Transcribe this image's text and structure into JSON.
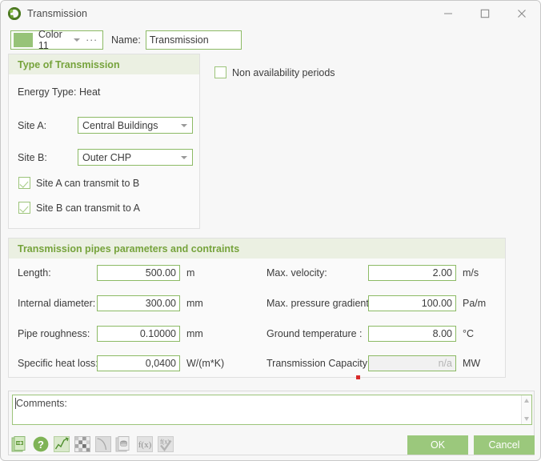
{
  "window": {
    "title": "Transmission",
    "app_icon": "ring-icon",
    "controls": {
      "minimize": "minimize-icon",
      "maximize": "maximize-icon",
      "close": "close-icon"
    }
  },
  "header_row": {
    "color_value": "Color 11",
    "color_swatch_hex": "#97c378",
    "ellipsis": "···",
    "name_label": "Name:",
    "name_value": "Transmission"
  },
  "type_group": {
    "title": "Type of Transmission",
    "energy_type_label": "Energy Type:",
    "energy_type_value": "Heat",
    "site_a_label": "Site A:",
    "site_a_value": "Central Buildings",
    "site_b_label": "Site B:",
    "site_b_value": "Outer CHP",
    "checkbox_a_to_b": "Site A can transmit to B",
    "checkbox_b_to_a": "Site B can transmit to A",
    "checkbox_a_to_b_checked": true,
    "checkbox_b_to_a_checked": true
  },
  "non_availability": {
    "label": "Non availability periods",
    "checked": false
  },
  "pipes_group": {
    "title": "Transmission pipes parameters and contraints",
    "left_fields": [
      {
        "label": "Length:",
        "value": "500.00",
        "unit": "m",
        "disabled": false
      },
      {
        "label": "Internal diameter:",
        "value": "300.00",
        "unit": "mm",
        "disabled": false
      },
      {
        "label": "Pipe roughness:",
        "value": "0.10000",
        "unit": "mm",
        "disabled": false
      },
      {
        "label": "Specific heat loss:",
        "value": "0,0400",
        "unit": "W/(m*K)",
        "disabled": false
      }
    ],
    "right_fields": [
      {
        "label": "Max. velocity:",
        "value": "2.00",
        "unit": "m/s",
        "disabled": false
      },
      {
        "label": "Max. pressure gradient:",
        "value": "100.00",
        "unit": "Pa/m",
        "disabled": false
      },
      {
        "label": "Ground temperature :",
        "value": "8.00",
        "unit": "°C",
        "disabled": false
      },
      {
        "label": "Transmission Capacity:",
        "value": "n/a",
        "unit": "MW",
        "disabled": true
      }
    ]
  },
  "comments": {
    "text": "Comments:"
  },
  "toolbar": {
    "icons": [
      "export-document-icon",
      "help-icon",
      "chart-line-icon",
      "heatmap-icon",
      "curve-icon",
      "database-document-icon",
      "function-icon",
      "function-check-icon"
    ]
  },
  "buttons": {
    "ok": "OK",
    "cancel": "Cancel"
  },
  "colors": {
    "accent_green": "#9bc87c",
    "header_green": "#76a33c",
    "border_green": "#8cba65",
    "panel_bg": "#fafafa",
    "window_bg": "#f7f7f7",
    "marker_red": "#d92b2b"
  }
}
